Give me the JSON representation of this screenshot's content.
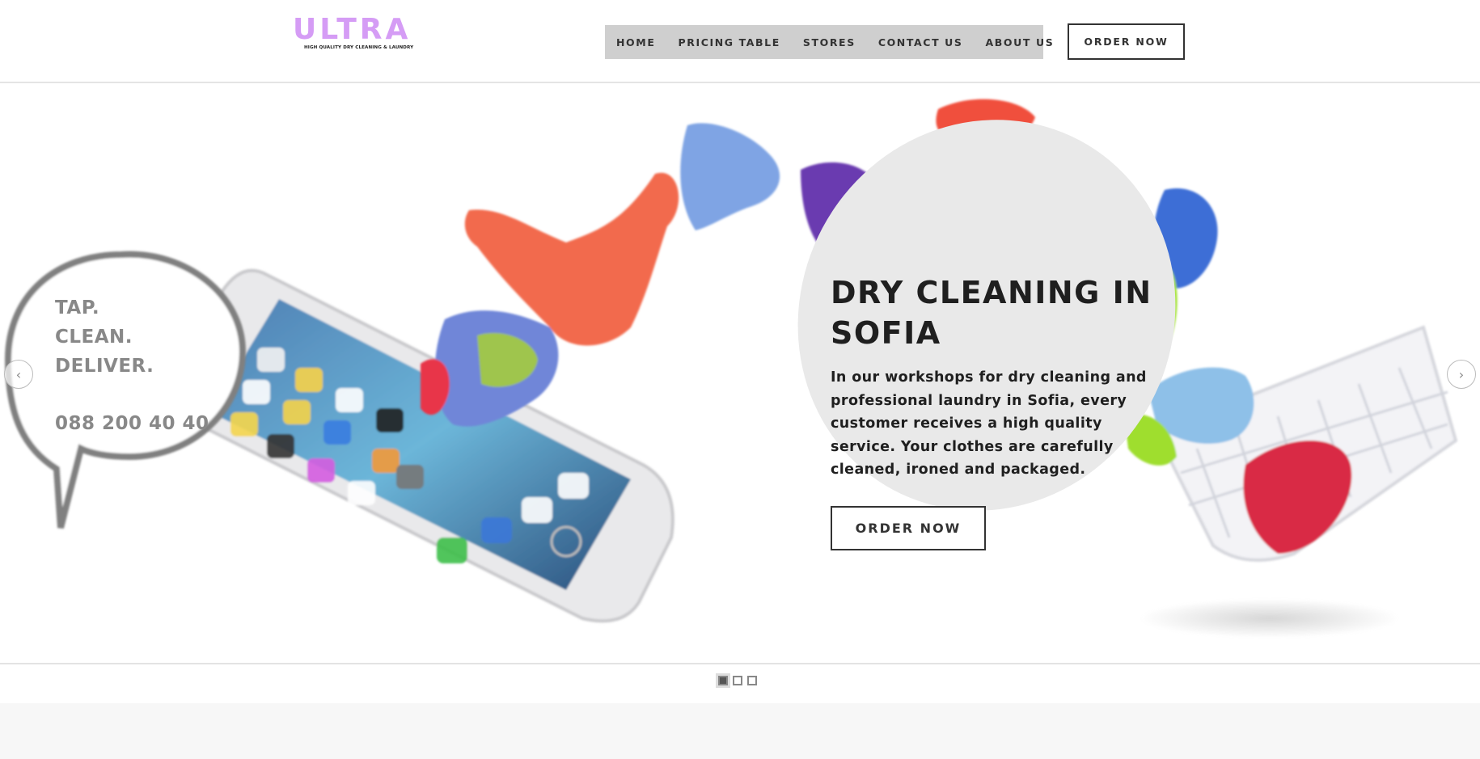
{
  "header": {
    "logo_text": "ULTRA",
    "logo_tagline": "HIGH QUALITY DRY CLEANING & LAUNDRY",
    "nav": [
      "HOME",
      "PRICING TABLE",
      "STORES",
      "CONTACT US",
      "ABOUT US"
    ],
    "order_label": "ORDER NOW"
  },
  "hero": {
    "title": "DRY CLEANING IN SOFIA",
    "text": "In our workshops for dry cleaning and professional laundry in Sofia, every customer receives a high quality service. Your clothes are carefully cleaned, ironed and packaged.",
    "button_label": "ORDER NOW",
    "bubble": {
      "line1": "TAP.",
      "line2": "CLEAN.",
      "line3": "DELIVER.",
      "phone": "088 200 40 40"
    },
    "prev_icon": "‹",
    "next_icon": "›"
  },
  "slider": {
    "slide_count": 3,
    "active_index": 0
  },
  "colors": {
    "logo": "#d59cf5",
    "nav_bg": "#cfcfcf",
    "oval": "#e9e9e9",
    "text": "#1f1f1f"
  }
}
